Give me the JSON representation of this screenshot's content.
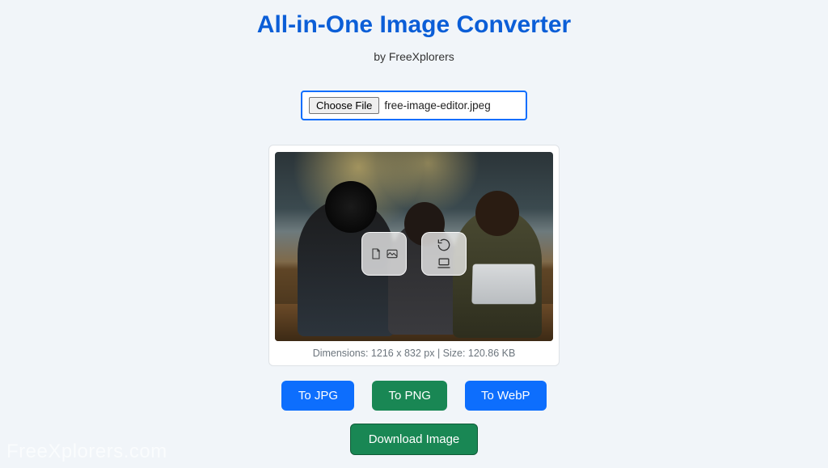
{
  "header": {
    "title": "All-in-One Image Converter",
    "byline": "by FreeXplorers"
  },
  "file_input": {
    "button_label": "Choose File",
    "selected_filename": "free-image-editor.jpeg"
  },
  "preview": {
    "meta_text": "Dimensions: 1216 x 832 px | Size: 120.86 KB"
  },
  "convert_buttons": {
    "jpg": "To JPG",
    "png": "To PNG",
    "webp": "To WebP"
  },
  "download": {
    "label": "Download Image"
  },
  "watermark": "FreeXplorers.com"
}
